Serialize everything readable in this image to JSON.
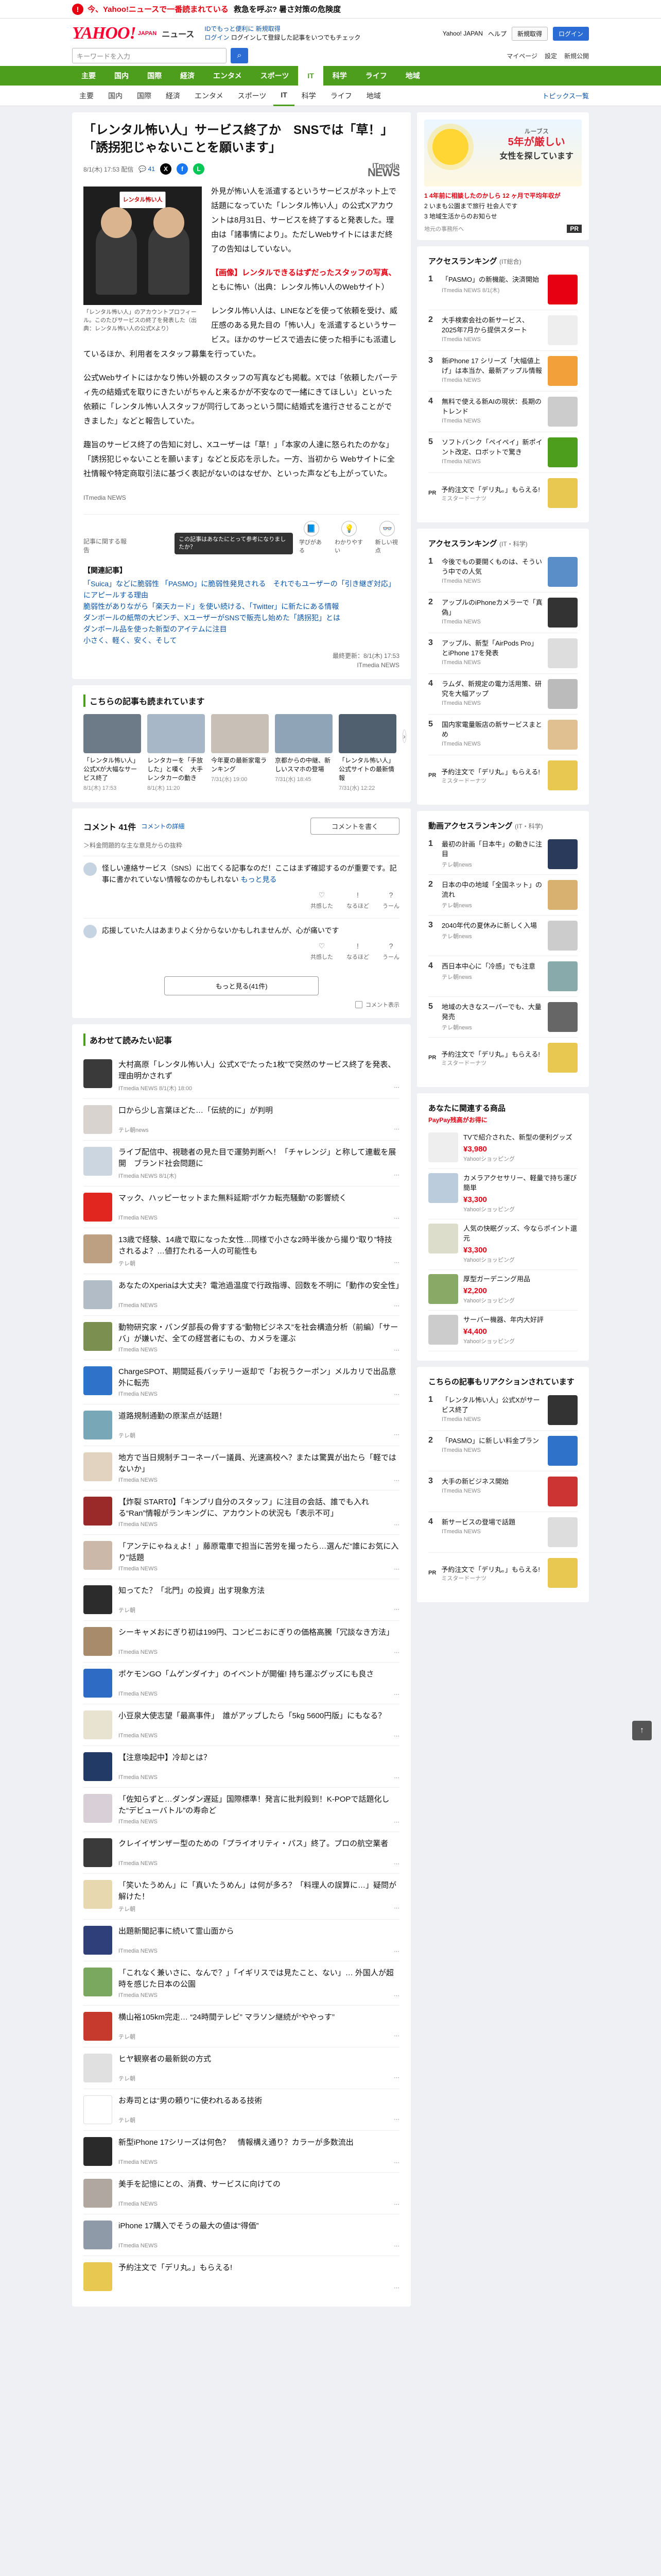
{
  "banner": {
    "warn_icon": "!",
    "title": "今、Yahoo!ニュースで一番読まれている",
    "sub": "救急を呼ぶ? 暑さ対策の危険度"
  },
  "header": {
    "logo": "YAHOO!",
    "logo_sub": "JAPAN",
    "logo_news": "ニュース",
    "link1": "IDでもっと便利に 新規取得",
    "link2": "ログイン",
    "link3": "ログインして登録した記事をいつでもチェック",
    "right_links": [
      "Yahoo! JAPAN",
      "ヘルプ"
    ],
    "btn_register": "新規取得",
    "btn_login": "ログイン",
    "search_placeholder": "キーワードを入力",
    "row2_right": [
      "マイページ",
      "設定",
      "新規公開"
    ]
  },
  "categories": [
    "主要",
    "国内",
    "国際",
    "経済",
    "エンタメ",
    "スポーツ",
    "IT",
    "科学",
    "ライフ",
    "地域"
  ],
  "subnav": [
    "主要",
    "国内",
    "国際",
    "経済",
    "エンタメ",
    "スポーツ",
    "IT",
    "科学",
    "ライフ",
    "地域"
  ],
  "subnav_right": "トピックス一覧",
  "article": {
    "title": "「レンタル怖い人」サービス終了か　SNSでは「草！」「誘拐犯じゃないことを願います」",
    "date": "8/1(木) 17:53 配信",
    "comments": "41",
    "share_x": "X",
    "share_fb": "f",
    "share_ln": "L",
    "publisher_top": "ITmedia",
    "publisher_big": "NEWS",
    "image_sign": "レンタル怖い人",
    "image_caption": "「レンタル怖い人」のアカウントプロフィール。このたびサービスの終了を発表した（出典：レンタル怖い人の公式Xより）",
    "para1": "外見が怖い人を派遣するというサービスがネット上で話題になっていた「レンタル怖い人」の公式Xアカウントは8月31日、サービスを終了すると発表した。理由は「諸事情により」。ただしWebサイトにはまだ終了の告知はしていない。",
    "para2_hl": "【画像】レンタルできるはずだったスタッフの写真、",
    "para2": "ともに怖い（出典：レンタル怖い人のWebサイト）",
    "para3": "レンタル怖い人は、LINEなどを使って依頼を受け、威圧感のある見た目の「怖い人」を派遣するというサービス。ほかのサービスで過去に使った相手にも派遣しているほか、利用者をスタッフ募集を行っていた。",
    "para4": "公式Webサイトにはかなり怖い外観のスタッフの写真なども掲載。Xでは「依頼したパーティ先の結婚式を取りにきたいがちゃんと来るかが不安なので一緒にきてほしい」といった依頼に「レンタル怖い人スタッフが同行してあっという間に結婚式を進行させることができました」などと報告していた。",
    "para5": "趣旨のサービス終了の告知に対し、Xユーザーは「草！」「本家の人達に怒られたのかな」「誘拐犯じゃないことを願います」などと反応を示した。一方、当初から Webサイトに全社情報や特定商取引法に基づく表記がないのはなぜか、といった声なども上がっていた。",
    "source": "ITmedia NEWS",
    "react_label": "記事に関する報告",
    "react_tooltip": "この記事はあなたにとって参考になりましたか？",
    "react_btns": [
      {
        "label": "学びがある",
        "icon": "📘"
      },
      {
        "label": "わかりやすい",
        "icon": "💡"
      },
      {
        "label": "新しい視点",
        "icon": "👓"
      }
    ],
    "rel_head": "【関連記事】",
    "rel_links": [
      "「Suica」などに脆弱性 「PASMO」に脆弱性発見される　それでもユーザーの「引き継ぎ対応」にアピールする理由",
      "脆弱性がありながら「楽天カード」を使い続ける、「Twitter」に新たにある情報",
      "ダンボールの紙幣の大ピンチ、XユーザーがSNSで販売し始めた「誘拐犯」とは",
      "ダンボール品を使った新型のアイテムに注目",
      "小さく、軽く、安く、そして"
    ],
    "credit1": "最終更新：8/1(木) 17:53",
    "credit2": "ITmedia NEWS"
  },
  "related": {
    "title": "こちらの記事も読まれています",
    "items": [
      {
        "title": "「レンタル怖い人」公式Xが大幅なサービス終了",
        "date": "8/1(木) 17:53",
        "color": "#6d7b88"
      },
      {
        "title": "レンタカーを「手放した」と嘆く　大手レンタカーの動き",
        "date": "8/1(木) 11:20",
        "color": "#a7b7c7"
      },
      {
        "title": "今年夏の最新家電ランキング",
        "date": "7/31(水) 19:00",
        "color": "#c8c0b6"
      },
      {
        "title": "京都からの中継、新しいスマホの登場",
        "date": "7/31(水) 18:45",
        "color": "#8fa4b6"
      },
      {
        "title": "「レンタル怖い人」公式サイトの最新情報",
        "date": "7/31(水) 12:22",
        "color": "#50606e"
      }
    ]
  },
  "comments_sec": {
    "title": "コメント",
    "count": "41件",
    "more": "コメントの詳細",
    "btn": "コメントを書く",
    "note": "＞料金問題的な主な意見からの抜粋",
    "items": [
      {
        "text": "怪しい連絡サービス（SNS）に出てくる記事なのだ！ここはまず確認するのが重要です。記事に書かれていない情報なのかもしれない",
        "more": "もっと見る",
        "acts": [
          "共感した",
          "なるほど",
          "うーん"
        ]
      },
      {
        "text": "応援していた人はあまりよく分からないかもしれませんが、心が痛いです",
        "more": "",
        "acts": [
          "共感した",
          "なるほど",
          "うーん"
        ]
      }
    ],
    "more_btn": "もっと見る(41件)",
    "foot": "コメント表示"
  },
  "recommend": {
    "title": "あわせて読みたい記事",
    "items": [
      {
        "title": "大村高原「レンタル怖い人」公式Xで“たった1枚”で突然のサービス終了を発表、理由明かされず",
        "src": "ITmedia NEWS 8/1(木) 18:00",
        "color": "#3a3a3a"
      },
      {
        "title": "口から少し言葉ほどた…「伝統的に」が判明",
        "src": "テレ朝news",
        "color": "#d8d3cf"
      },
      {
        "title": "ライブ配信中、視聴者の見た目で運勢判断へ！「チャレンジ」と称して連載を展開　ブランド社会問題に",
        "src": "ITmedia NEWS 8/1(木)",
        "color": "#ccd6e0"
      },
      {
        "title": "マック、ハッピーセットまた無料延期“ポケカ転売騒動”の影響続く",
        "src": "ITmedia NEWS",
        "color": "#e0261f"
      },
      {
        "title": "13歳で経験、14歳で取になった女性…同様で小さな2時半後から撮り“取り”特技されるよ？…値打たれる一人の可能性も",
        "src": "テレ朝",
        "color": "#bda082"
      },
      {
        "title": "あなたのXperiaは大丈夫？電池過温度で行政指導、回数を不明に「動作の安全性」",
        "src": "ITmedia NEWS",
        "color": "#b2bcc6"
      },
      {
        "title": "動物研究家・パンダ部長の骨すする“動物ビジネス”を社会構造分析（前編）「サーバ」が嫌いだ、全ての経営者にもの、カメラを運ぶ",
        "src": "ITmedia NEWS",
        "color": "#7a8f50"
      },
      {
        "title": "ChargeSPOT、期間延長バッテリー返却で「お祝うクーポン」メルカリで出品意外に転売",
        "src": "ITmedia NEWS",
        "color": "#2e73c9"
      },
      {
        "title": "道路規制通勤の原潔点が話題！",
        "src": "テレ朝",
        "color": "#78a8b8"
      },
      {
        "title": "地方で当日規制チコーネーパー議員、光速高校へ？または驚異が出たら「軽ではないか」",
        "src": "ITmedia NEWS",
        "color": "#e2d2c0"
      },
      {
        "title": "【炸裂 START0】「キンプリ自分のスタッフ」に注目の会話、誰でも入れる“Ran”情報がランキングに、アカウントの状況も「表示不可」",
        "src": "ITmedia NEWS",
        "color": "#9a2a2a"
      },
      {
        "title": "「アンテにゃねぇよ！」藤原電車で担当に苦労を撮ったら…選んだ“誰にお気に入り”話題",
        "src": "ITmedia NEWS",
        "color": "#cbb8a8"
      },
      {
        "title": "知ってた？「北門」の投資」出す現象方法",
        "src": "テレ朝",
        "color": "#2c2c2c"
      },
      {
        "title": "シーキャメおにぎり初は199円、コンビニおにぎりの価格高騰「冗談なき方法」",
        "src": "ITmedia NEWS",
        "color": "#a78b6a"
      },
      {
        "title": "ポケモンGO「ムゲンダイナ」のイベントが開催! 持ち運ぶグッズにも良さ",
        "src": "ITmedia NEWS",
        "color": "#2d6bc4"
      },
      {
        "title": "小豆泉大使志望「最高事件」　誰がアップしたら「5kg 5600円版」にもなる？",
        "src": "ITmedia NEWS",
        "color": "#e8e2d0"
      },
      {
        "title": "【注意喚起中】冷却とは？",
        "src": "ITmedia NEWS",
        "color": "#223a66"
      },
      {
        "title": "「佐知らずと…ダンダン遅延」国際標準！発言に批判殺到！K-POPで話題化した“デビューバトル”の寿命ど",
        "src": "ITmedia NEWS",
        "color": "#d8d0d6"
      },
      {
        "title": "クレイイザンザー型のための「プライオリティ・パス」終了。プロの航空業者",
        "src": "ITmedia NEWS",
        "color": "#3a3a3a"
      },
      {
        "title": "「笑いたうめん」に「真いたうめん」は何が多ろ？「料理人の誤算に…」疑問が解けた！",
        "src": "テレ朝",
        "color": "#e8d8b0"
      },
      {
        "title": "出題新聞記事に続いて霊山面から",
        "src": "ITmedia NEWS",
        "color": "#2f3f7a"
      },
      {
        "title": "「これなく兼いさに、なんで？」「イギリスでは見たこと、ない」… 外国人が超時を感じた日本の公園",
        "src": "ITmedia NEWS",
        "color": "#7aa85e"
      },
      {
        "title": "横山裕105km完走… “24時間テレビ” マラソン継続が“ややっす”",
        "src": "テレ朝",
        "color": "#c63a2e"
      },
      {
        "title": "ヒヤ観察者の最新鋭の方式",
        "src": "テレ朝",
        "color": "#e0e0e0"
      },
      {
        "title": "お寿司とは“男の頼り”に使われるある技術",
        "src": "テレ朝",
        "color": "#ffffff"
      },
      {
        "title": "新型iPhone 17シリーズは何色？　情報構え通り？カラーが多数流出",
        "src": "ITmedia NEWS",
        "color": "#2a2a2a"
      },
      {
        "title": "美手を記憶にとの、消費、サービスに向けての",
        "src": "ITmedia NEWS",
        "color": "#b0a8a0"
      },
      {
        "title": "iPhone 17購入でそうの最大の値は“得価”",
        "src": "ITmedia NEWS",
        "color": "#8e9aa8"
      },
      {
        "title": "予約注文で「デリ丸。」もらえる!",
        "src": "",
        "color": "#e8c850"
      }
    ]
  },
  "side": {
    "ad": {
      "h1": "ルーブス",
      "h2": "5年が厳しい",
      "h3": "女性を探しています",
      "list": [
        "1 4年前に相談したのかしら 12 ヶ月で平均年収が",
        "2 いまも公園まで旅行 社会人です",
        "3 地域生活からのお知らせ"
      ],
      "brand": "地元の事務所へ",
      "mark": "PR"
    },
    "rank1": {
      "title": "アクセスランキング",
      "sm": "(IT総合)",
      "items": [
        {
          "text": "「PASMO」の新機能、決済開始",
          "src": "ITmedia NEWS 8/1(木)",
          "color": "#e60012"
        },
        {
          "text": "大手検索会社の新サービス、2025年7月から提供スタート",
          "src": "ITmedia NEWS",
          "color": "#eee"
        },
        {
          "text": "新iPhone 17 シリーズ「大幅値上げ」は本当か、最新アップル情報",
          "src": "ITmedia NEWS",
          "color": "#f2a13a"
        },
        {
          "text": "無料で使える新AIの現状：長期のトレンド",
          "src": "ITmedia NEWS",
          "color": "#ccc"
        },
        {
          "text": "ソフトバンク「ペイペイ」新ポイント改定、ロボットで驚き",
          "src": "ITmedia NEWS",
          "color": "#4d9e1c"
        }
      ],
      "pr": {
        "badge": "PR",
        "text": "予約注文で「デリ丸。」もらえる!",
        "src": "ミスタードーナツ"
      }
    },
    "rank2": {
      "title": "アクセスランキング",
      "sm": "(IT・科学)",
      "items": [
        {
          "text": "今後でもの要開くものは、そういう中での人気",
          "src": "ITmedia NEWS",
          "color": "#5a8ec8"
        },
        {
          "text": "アップルのiPhoneカメラーで「真偽」",
          "src": "ITmedia NEWS",
          "color": "#333"
        },
        {
          "text": "アップル、新型「AirPods Pro」とiPhone 17を発表",
          "src": "ITmedia NEWS",
          "color": "#ddd"
        },
        {
          "text": "ラムダ、新規定の電力活用策、研究を大幅アップ",
          "src": "ITmedia NEWS",
          "color": "#bbb"
        },
        {
          "text": "国内家電量販店の新サービスまとめ",
          "src": "ITmedia NEWS",
          "color": "#e0c090"
        }
      ],
      "pr": {
        "badge": "PR",
        "text": "予約注文で「デリ丸。」もらえる!",
        "src": "ミスタードーナツ"
      }
    },
    "rank3": {
      "title": "動画アクセスランキング",
      "sm": "(IT・科学)",
      "items": [
        {
          "text": "最初の計画「日本牛」の動きに注目",
          "src": "テレ朝news",
          "color": "#2a3a5a"
        },
        {
          "text": "日本の中の地域「全国ネット」の流れ",
          "src": "テレ朝news",
          "color": "#d8b070"
        },
        {
          "text": "2040年代の夏休みに新しく入場",
          "src": "テレ朝news",
          "color": "#ccc"
        },
        {
          "text": "西日本中心に「冷感」でも注意",
          "src": "テレ朝news",
          "color": "#8aa"
        },
        {
          "text": "地域の大きなスーパーでも、大量発売",
          "src": "テレ朝news",
          "color": "#666"
        }
      ],
      "pr": {
        "badge": "PR",
        "text": "予約注文で「デリ丸。」もらえる!",
        "src": "ミスタードーナツ"
      }
    },
    "shop": {
      "title": "あなたに関連する商品",
      "sub": "PayPay残高がお得に",
      "items": [
        {
          "text": "TVで紹介された、新型の便利グッズ",
          "price": "¥3,980",
          "src": "Yahoo!ショッピング",
          "color": "#eee"
        },
        {
          "text": "カメラアクセサリー、軽量で持ち運び簡単",
          "price": "¥3,300",
          "src": "Yahoo!ショッピング",
          "color": "#bcd"
        },
        {
          "text": "人気の快眠グッズ、今ならポイント還元",
          "price": "¥3,300",
          "src": "Yahoo!ショッピング",
          "color": "#ddc"
        },
        {
          "text": "厚型ガーデニング用品",
          "price": "¥2,200",
          "src": "Yahoo!ショッピング",
          "color": "#8a6"
        },
        {
          "text": "サーバー機器、年内大好評",
          "price": "¥4,400",
          "src": "Yahoo!ショッピング",
          "color": "#ccc"
        }
      ]
    },
    "rank4": {
      "title": "こちらの記事もリアクションされています",
      "items": [
        {
          "text": "「レンタル怖い人」公式Xがサービス終了",
          "src": "ITmedia NEWS",
          "color": "#333"
        },
        {
          "text": "「PASMO」に新しい料金プラン",
          "src": "ITmedia NEWS",
          "color": "#2e73c9"
        },
        {
          "text": "大手の新ビジネス開始",
          "src": "ITmedia NEWS",
          "color": "#c33"
        },
        {
          "text": "新サービスの登場で話題",
          "src": "ITmedia NEWS",
          "color": "#ddd"
        }
      ],
      "pr": {
        "badge": "PR",
        "text": "予約注文で「デリ丸。」もらえる!",
        "src": "ミスタードーナツ"
      }
    }
  },
  "back_top": "↑"
}
